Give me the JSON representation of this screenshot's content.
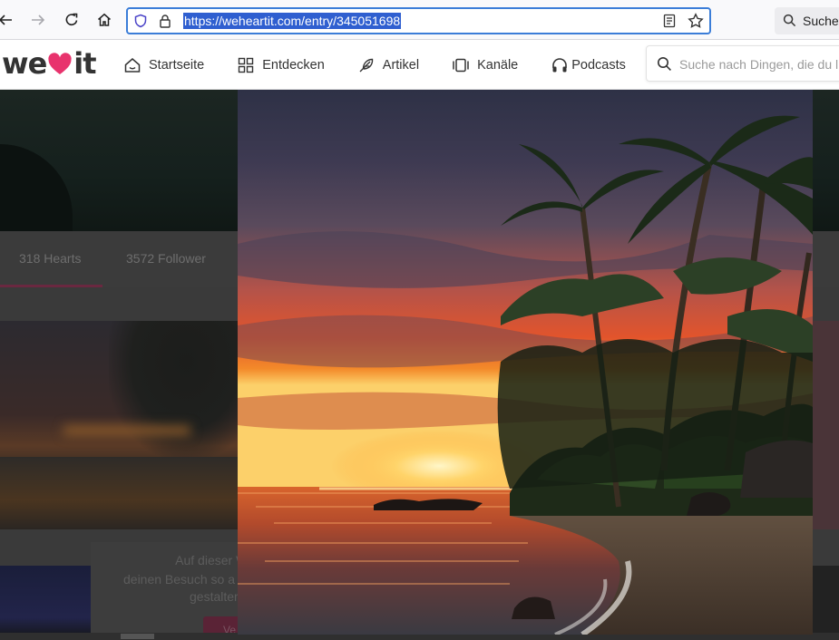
{
  "browser": {
    "url": "https://weheartit.com/entry/345051698",
    "search_label": "Suchen",
    "icons": [
      "back-icon",
      "forward-icon",
      "reload-icon",
      "home-icon",
      "shield-icon",
      "lock-icon",
      "reader-view-icon",
      "bookmark-star-icon",
      "search-icon"
    ]
  },
  "site": {
    "logo_left": "we",
    "logo_right": "it",
    "nav": [
      {
        "label": "Startseite",
        "icon": "home-icon"
      },
      {
        "label": "Entdecken",
        "icon": "grid-icon"
      },
      {
        "label": "Artikel",
        "icon": "feather-icon"
      },
      {
        "label": "Kanäle",
        "icon": "channels-icon"
      },
      {
        "label": "Podcasts",
        "icon": "headphones-icon"
      }
    ],
    "search_placeholder": "Suche nach Dingen, die du liebst"
  },
  "profile": {
    "tabs": [
      "318 Hearts",
      "3572 Follower"
    ]
  },
  "cookie_banner": {
    "line1": "Auf dieser Website wer",
    "line2": "deinen Besuch so a",
    "line3": "gestalter",
    "button": "Ve"
  },
  "colors": {
    "brand_pink": "#e8336d",
    "url_highlight": "#2f5fd0",
    "focus_ring": "#3b7dd8"
  }
}
